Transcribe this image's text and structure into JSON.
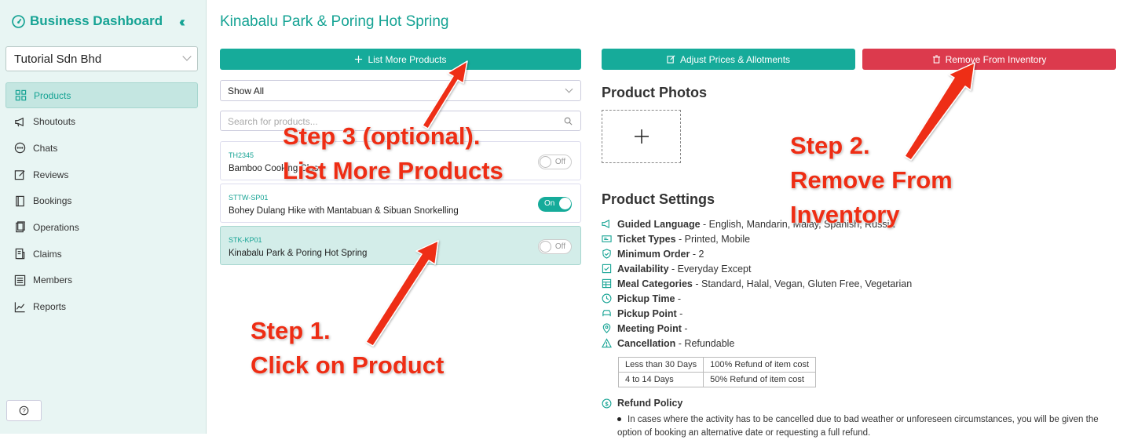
{
  "sidebar": {
    "brand": "Business Dashboard",
    "company": "Tutorial Sdn Bhd",
    "items": [
      {
        "label": "Products",
        "icon": "grid-icon"
      },
      {
        "label": "Shoutouts",
        "icon": "megaphone-icon"
      },
      {
        "label": "Chats",
        "icon": "chat-icon"
      },
      {
        "label": "Reviews",
        "icon": "edit-icon"
      },
      {
        "label": "Bookings",
        "icon": "book-icon"
      },
      {
        "label": "Operations",
        "icon": "clipboard-icon"
      },
      {
        "label": "Claims",
        "icon": "receipt-icon"
      },
      {
        "label": "Members",
        "icon": "list-icon"
      },
      {
        "label": "Reports",
        "icon": "chart-icon"
      }
    ],
    "help": "?"
  },
  "main": {
    "title": "Kinabalu Park & Poring Hot Spring",
    "list_more_label": "List More Products",
    "adjust_label": "Adjust Prices & Allotments",
    "remove_label": "Remove From Inventory",
    "filter_value": "Show All",
    "search_placeholder": "Search for products...",
    "products": [
      {
        "code": "TH2345",
        "name": "Bamboo Cooking Class",
        "status": "Off"
      },
      {
        "code": "STTW-SP01",
        "name": "Bohey Dulang Hike with Mantabuan & Sibuan Snorkelling",
        "status": "On"
      },
      {
        "code": "STK-KP01",
        "name": "Kinabalu Park & Poring Hot Spring",
        "status": "Off"
      }
    ],
    "photos_title": "Product Photos",
    "settings_title": "Product Settings",
    "settings": [
      {
        "label": "Guided Language",
        "value": " - English, Mandarin, Malay, Spanish, Russia"
      },
      {
        "label": "Ticket Types",
        "value": " - Printed, Mobile"
      },
      {
        "label": "Minimum Order",
        "value": " - 2"
      },
      {
        "label": "Availability",
        "value": " - Everyday Except"
      },
      {
        "label": "Meal Categories",
        "value": " - Standard, Halal, Vegan, Gluten Free, Vegetarian"
      },
      {
        "label": "Pickup Time",
        "value": " -"
      },
      {
        "label": "Pickup Point",
        "value": " -"
      },
      {
        "label": "Meeting Point",
        "value": " -"
      },
      {
        "label": "Cancellation",
        "value": " - Refundable"
      }
    ],
    "refund_table": [
      [
        "Less than 30 Days",
        "100% Refund of item cost"
      ],
      [
        "4 to 14 Days",
        "50% Refund of item cost"
      ]
    ],
    "policy_title": "Refund Policy",
    "policy_text": "In cases where the activity has to be cancelled due to bad weather or unforeseen circumstances, you will be given the option of booking an alternative date or requesting a full refund."
  },
  "annotations": {
    "step3_line1": "Step 3 (optional).",
    "step3_line2": "List More Products",
    "step2_line1": "Step 2.",
    "step2_line2": "Remove From",
    "step2_line3": "Inventory",
    "step1_line1": "Step 1.",
    "step1_line2": "Click on Product"
  },
  "colors": {
    "accent": "#16ab9a",
    "danger": "#dc3a4d",
    "annotation": "#ee2d14"
  }
}
